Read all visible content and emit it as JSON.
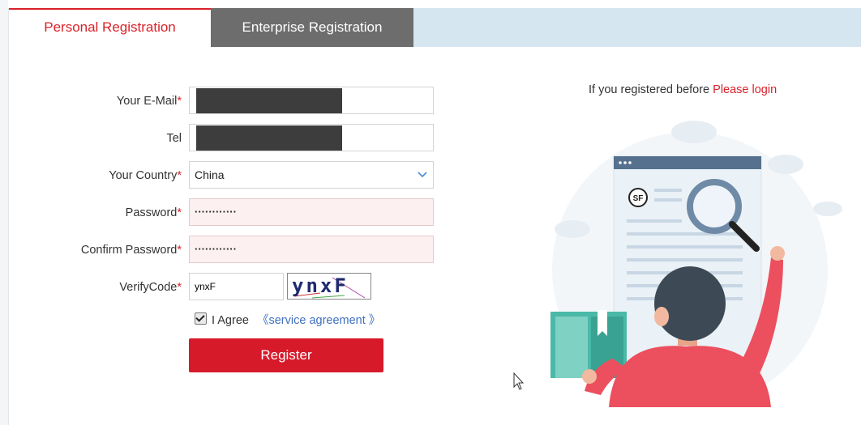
{
  "tabs": {
    "personal_label": "Personal Registration",
    "enterprise_label": "Enterprise Registration"
  },
  "form": {
    "email_label": "Your E-Mail",
    "tel_label": "Tel",
    "country_label": "Your Country",
    "country_value": "China",
    "password_label": "Password",
    "password_value": "············",
    "confirm_label": "Confirm Password",
    "confirm_value": "············",
    "verify_label": "VerifyCode",
    "verify_value": "ynxF",
    "captcha_text": "ynxF",
    "required_mark": "*"
  },
  "agreement": {
    "agree_label": "I Agree",
    "link_label": "《service agreement 》",
    "checked": true
  },
  "register_label": "Register",
  "login": {
    "prompt": "If you registered before",
    "link_label": "Please login"
  },
  "illustration": {
    "logo_text": "SF",
    "icon": "person-with-magnifier-illustration"
  },
  "colors": {
    "accent": "#d71a2a",
    "tab_inactive": "#6d6d6d",
    "tabbar_bg": "#d6e6f1",
    "link_blue": "#3f6fc0"
  }
}
